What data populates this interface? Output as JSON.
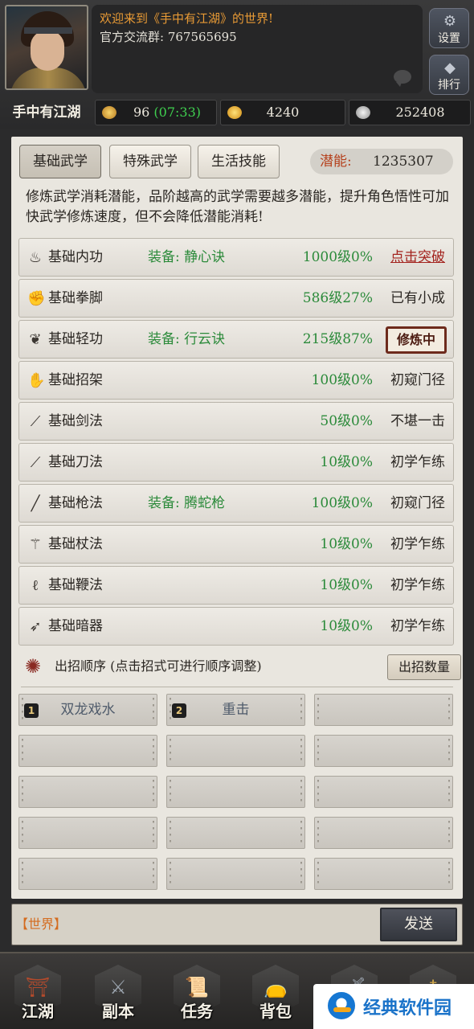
{
  "header": {
    "welcome": "欢迎来到《手中有江湖》的世界!",
    "group": "官方交流群: 767565695",
    "character_name": "手中有江湖",
    "settings_label": "设置",
    "rank_label": "排行",
    "stamina": "96",
    "stamina_timer": "(07:33)",
    "gold": "4240",
    "silver": "252408"
  },
  "tabs": [
    "基础武学",
    "特殊武学",
    "生活技能"
  ],
  "potential": {
    "label": "潜能:",
    "value": "1235307"
  },
  "description": "修炼武学消耗潜能，品阶越高的武学需要越多潜能，提升角色悟性可加快武学修炼速度，但不会降低潜能消耗!",
  "skills": [
    {
      "icon": "inner-power-icon",
      "name": "基础内功",
      "equip_label": "装备:",
      "equip": "静心诀",
      "level": "1000级0%",
      "status": "点击突破"
    },
    {
      "icon": "fist-icon",
      "name": "基础拳脚",
      "equip_label": "",
      "equip": "",
      "level": "586级27%",
      "status": "已有小成"
    },
    {
      "icon": "lightness-icon",
      "name": "基础轻功",
      "equip_label": "装备:",
      "equip": "行云诀",
      "level": "215级87%",
      "status": "修炼中"
    },
    {
      "icon": "parry-icon",
      "name": "基础招架",
      "equip_label": "",
      "equip": "",
      "level": "100级0%",
      "status": "初窥门径"
    },
    {
      "icon": "sword-icon",
      "name": "基础剑法",
      "equip_label": "",
      "equip": "",
      "level": "50级0%",
      "status": "不堪一击"
    },
    {
      "icon": "blade-icon",
      "name": "基础刀法",
      "equip_label": "",
      "equip": "",
      "level": "10级0%",
      "status": "初学乍练"
    },
    {
      "icon": "spear-icon",
      "name": "基础枪法",
      "equip_label": "装备:",
      "equip": "腾蛇枪",
      "level": "100级0%",
      "status": "初窥门径"
    },
    {
      "icon": "staff-icon",
      "name": "基础杖法",
      "equip_label": "",
      "equip": "",
      "level": "10级0%",
      "status": "初学乍练"
    },
    {
      "icon": "whip-icon",
      "name": "基础鞭法",
      "equip_label": "",
      "equip": "",
      "level": "10级0%",
      "status": "初学乍练"
    },
    {
      "icon": "hidden-weapon-icon",
      "name": "基础暗器",
      "equip_label": "",
      "equip": "",
      "level": "10级0%",
      "status": "初学乍练"
    }
  ],
  "order": {
    "text": "出招顺序 (点击招式可进行顺序调整)",
    "count_button": "出招数量"
  },
  "move_slots": [
    {
      "num": "1",
      "name": "双龙戏水"
    },
    {
      "num": "2",
      "name": "重击"
    }
  ],
  "chat": {
    "channel": "【世界】",
    "send_label": "发送"
  },
  "nav": [
    "江湖",
    "副本",
    "任务",
    "背包",
    "",
    ""
  ],
  "watermark": "经典软件园"
}
